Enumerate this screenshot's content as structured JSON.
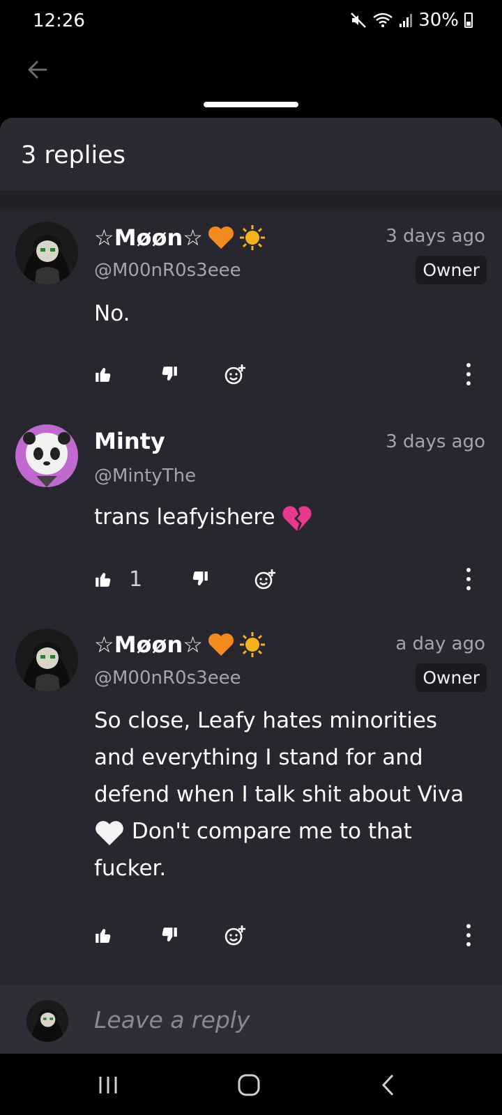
{
  "status_bar": {
    "time": "12:26",
    "battery": "30%"
  },
  "sheet": {
    "title": "3 replies"
  },
  "comments": [
    {
      "name": "☆Møøn☆",
      "handle": "@M00nR0s3eee",
      "time": "3 days ago",
      "badge": "Owner",
      "body": "No.",
      "likes": ""
    },
    {
      "name": "Minty",
      "handle": "@MintyThe",
      "time": "3 days ago",
      "badge": "",
      "body": "trans leafyishere",
      "likes": "1"
    },
    {
      "name": "☆Møøn☆",
      "handle": "@M00nR0s3eee",
      "time": "a day ago",
      "badge": "Owner",
      "body": "So close, Leafy hates minorities and everything I stand for and defend when I talk shit about Viva",
      "body_tail": "Don't compare me to that fucker.",
      "likes": ""
    }
  ],
  "reply_bar": {
    "placeholder": "Leave a reply"
  },
  "icons": {
    "back": "arrow-left-icon",
    "like": "thumbs-up-icon",
    "dislike": "thumbs-down-icon",
    "react": "add-reaction-icon",
    "more": "more-vertical-icon",
    "recents": "recents-icon",
    "home": "home-icon",
    "nav_back": "chevron-left-icon"
  },
  "colors": {
    "sheet_bg": "#28262e",
    "badge_bg": "#1b1a20",
    "muted_text": "#a5a3ad"
  }
}
